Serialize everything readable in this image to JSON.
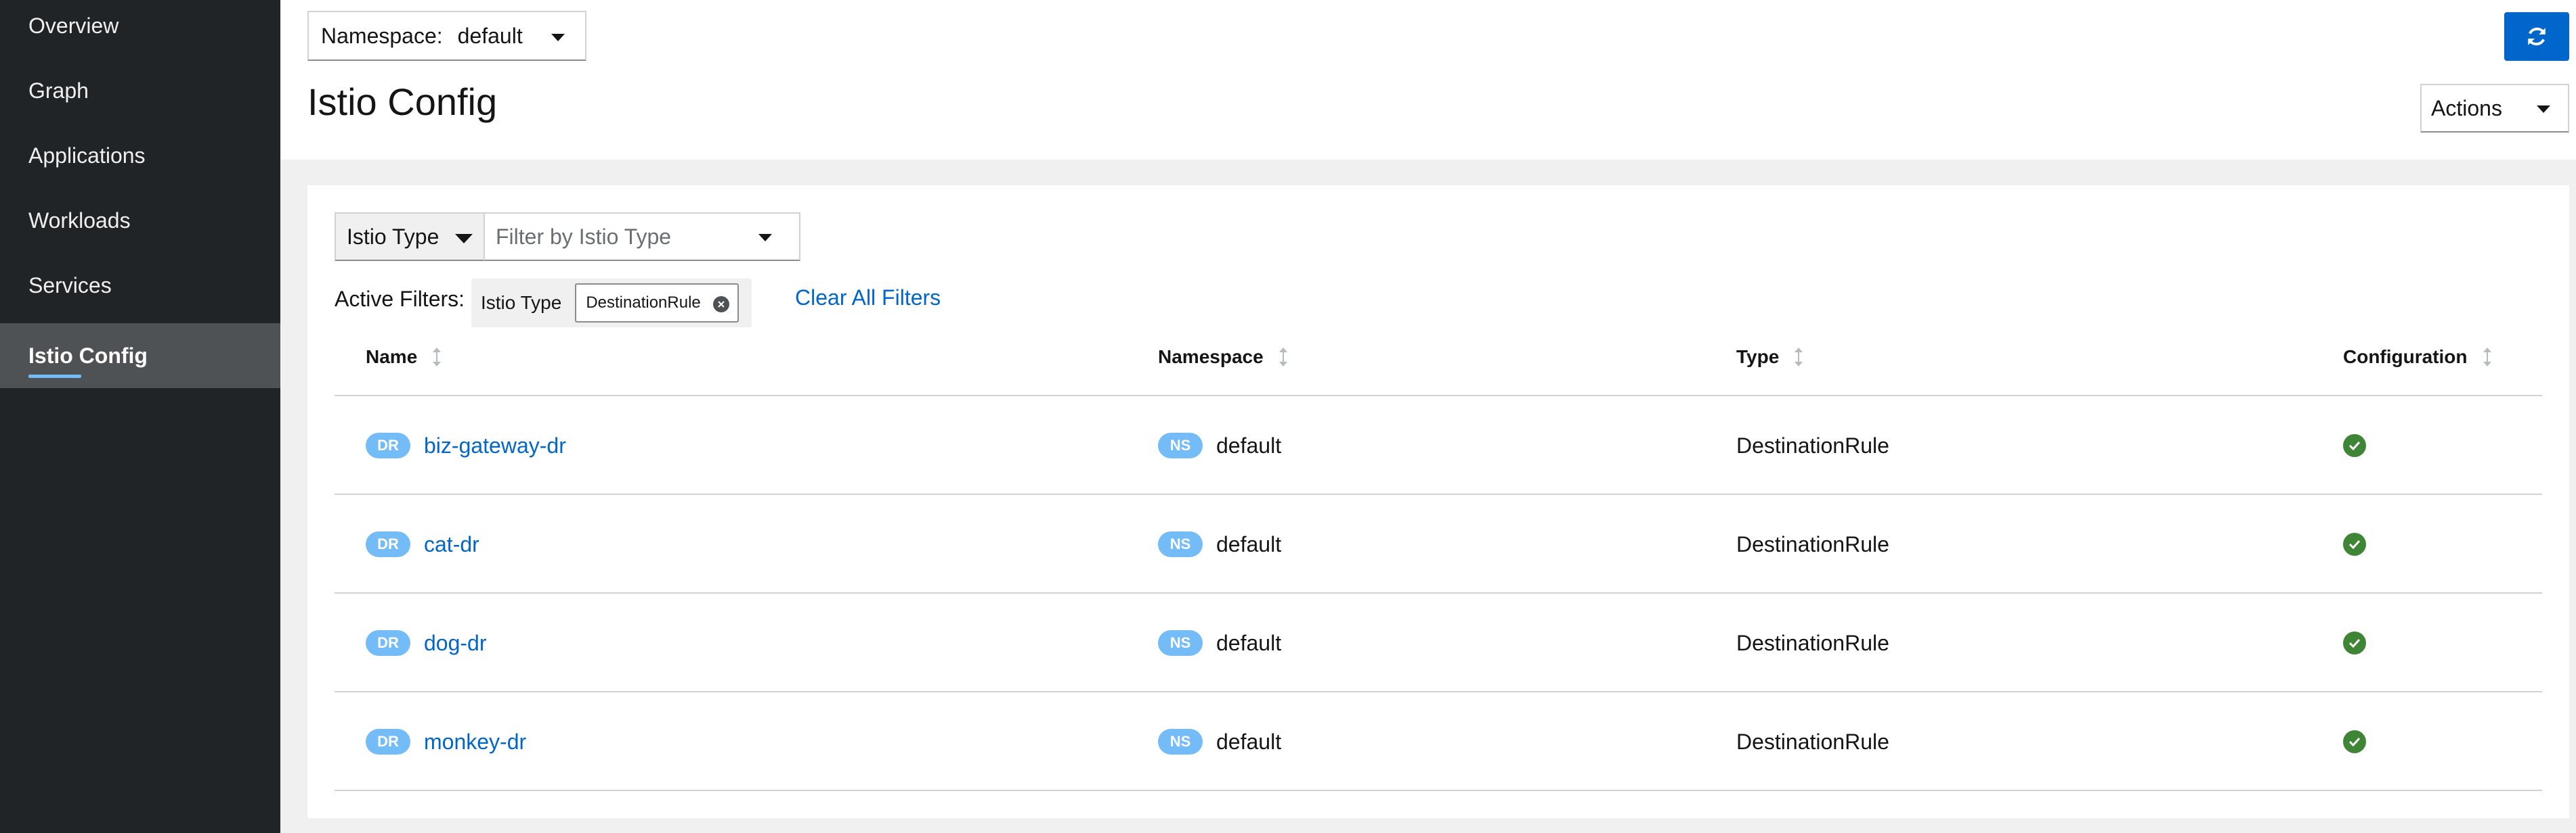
{
  "sidebar": {
    "items": [
      {
        "label": "Overview"
      },
      {
        "label": "Graph"
      },
      {
        "label": "Applications"
      },
      {
        "label": "Workloads"
      },
      {
        "label": "Services"
      },
      {
        "label": "Istio Config",
        "active": true
      }
    ]
  },
  "header": {
    "namespace_label": "Namespace:",
    "namespace_value": "default",
    "refresh_icon": "sync-icon",
    "title": "Istio Config",
    "actions_label": "Actions"
  },
  "filters": {
    "type_select": "Istio Type",
    "input_placeholder": "Filter by Istio Type",
    "active_label": "Active Filters:",
    "chip_category": "Istio Type",
    "chip_value": "DestinationRule",
    "clear_all": "Clear All Filters"
  },
  "table": {
    "columns": [
      "Name",
      "Namespace",
      "Type",
      "Configuration"
    ],
    "rows": [
      {
        "badge": "DR",
        "name": "biz-gateway-dr",
        "ns_badge": "NS",
        "namespace": "default",
        "type": "DestinationRule",
        "config": "valid"
      },
      {
        "badge": "DR",
        "name": "cat-dr",
        "ns_badge": "NS",
        "namespace": "default",
        "type": "DestinationRule",
        "config": "valid"
      },
      {
        "badge": "DR",
        "name": "dog-dr",
        "ns_badge": "NS",
        "namespace": "default",
        "type": "DestinationRule",
        "config": "valid"
      },
      {
        "badge": "DR",
        "name": "monkey-dr",
        "ns_badge": "NS",
        "namespace": "default",
        "type": "DestinationRule",
        "config": "valid"
      }
    ]
  },
  "colors": {
    "sidebar_bg": "#212427",
    "primary": "#0066cc",
    "badge": "#73bcf7",
    "success": "#3e8635"
  }
}
